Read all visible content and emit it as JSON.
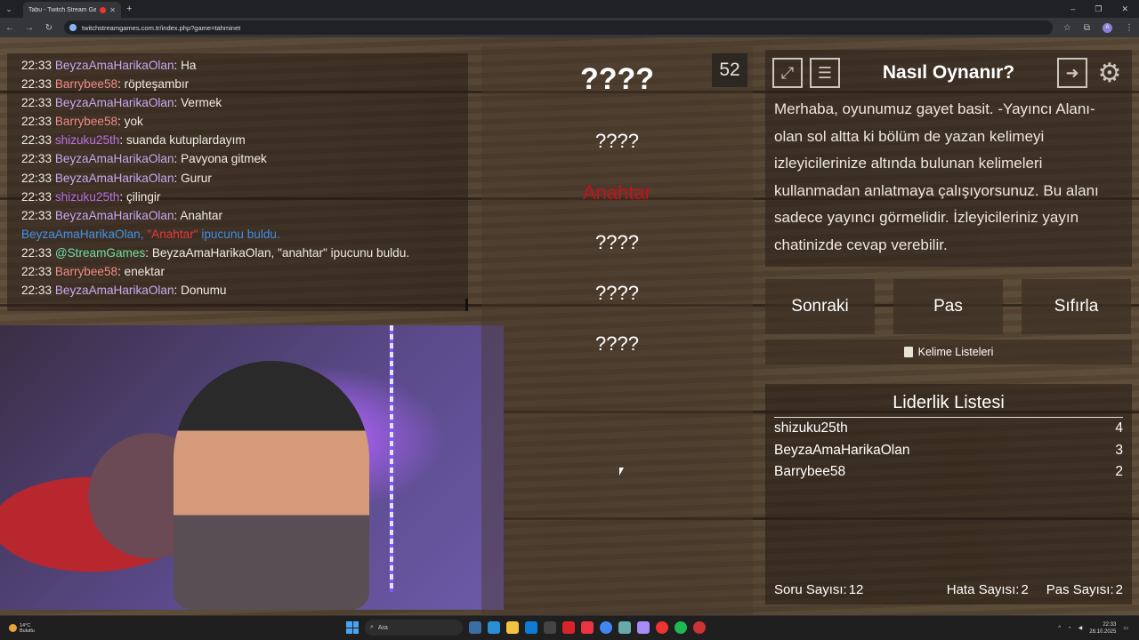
{
  "browser": {
    "tab_title": "Tabu - Twitch Stream Game",
    "url": "twitchstreamgames.com.tr/index.php?game=tahminet"
  },
  "chat": [
    {
      "time": "22:33",
      "user": "BeyzaAmaHarikaOlan",
      "color": "beyza",
      "sep": ": ",
      "msg": "Ha"
    },
    {
      "time": "22:33",
      "user": "Barrybee58",
      "color": "barry",
      "sep": ": ",
      "msg": "röpteşambır"
    },
    {
      "time": "22:33",
      "user": "BeyzaAmaHarikaOlan",
      "color": "beyza",
      "sep": ": ",
      "msg": "Vermek"
    },
    {
      "time": "22:33",
      "user": "Barrybee58",
      "color": "barry",
      "sep": ": ",
      "msg": "yok"
    },
    {
      "time": "22:33",
      "user": "shizuku25th",
      "color": "shiz",
      "sep": ": ",
      "msg": "suanda kutuplardayım"
    },
    {
      "time": "22:33",
      "user": "BeyzaAmaHarikaOlan",
      "color": "beyza",
      "sep": ": ",
      "msg": "Pavyona gitmek"
    },
    {
      "time": "22:33",
      "user": "BeyzaAmaHarikaOlan",
      "color": "beyza",
      "sep": ": ",
      "msg": "Gurur"
    },
    {
      "time": "22:33",
      "user": "shizuku25th",
      "color": "shiz",
      "sep": ": ",
      "msg": "çilingir"
    },
    {
      "time": "22:33",
      "user": "BeyzaAmaHarikaOlan",
      "color": "beyza",
      "sep": ": ",
      "msg": "Anahtar"
    },
    {
      "time": "",
      "user": "BeyzaAmaHarikaOlan,",
      "color": "blue",
      "sep": " ",
      "hl": "\"Anahtar\"",
      "msg": " ipucunu buldu."
    },
    {
      "time": "22:33",
      "user": "@StreamGames",
      "color": "sg",
      "sep": ": ",
      "msg": "BeyzaAmaHarikaOlan, \"anahtar\" ipucunu buldu."
    },
    {
      "time": "22:33",
      "user": "Barrybee58",
      "color": "barry",
      "sep": ": ",
      "msg": "enektar"
    },
    {
      "time": "22:33",
      "user": "BeyzaAmaHarikaOlan",
      "color": "beyza",
      "sep": ": ",
      "msg": "Donumu"
    }
  ],
  "game": {
    "timer": "52",
    "main_word": "????",
    "words": [
      "????",
      "Anahtar",
      "????",
      "????",
      "????"
    ]
  },
  "howto": {
    "title": "Nasıl Oynanır?",
    "text": "Merhaba, oyunumuz gayet basit. -Yayıncı Alanı- olan sol altta ki bölüm de yazan kelimeyi izleyicilerinize altında bulunan kelimeleri kullanmadan anlatmaya çalışıyorsunuz. Bu alanı sadece yayıncı görmelidir. İzleyicileriniz yayın chatinizde cevap verebilir."
  },
  "buttons": {
    "next": "Sonraki",
    "pass": "Pas",
    "reset": "Sıfırla",
    "lists": "Kelime Listeleri"
  },
  "leaderboard": {
    "title": "Liderlik Listesi",
    "rows": [
      {
        "name": "shizuku25th",
        "score": "4"
      },
      {
        "name": "BeyzaAmaHarikaOlan",
        "score": "3"
      },
      {
        "name": "Barrybee58",
        "score": "2"
      }
    ],
    "question_count_label": "Soru Sayısı:",
    "question_count": "12",
    "error_count_label": "Hata Sayısı:",
    "error_count": "2",
    "pass_count_label": "Pas Sayısı:",
    "pass_count": "2"
  },
  "taskbar": {
    "temp": "14°C",
    "weather": "Bulutlu",
    "search": "Ara",
    "time": "22:33",
    "date": "28.10.2025"
  }
}
